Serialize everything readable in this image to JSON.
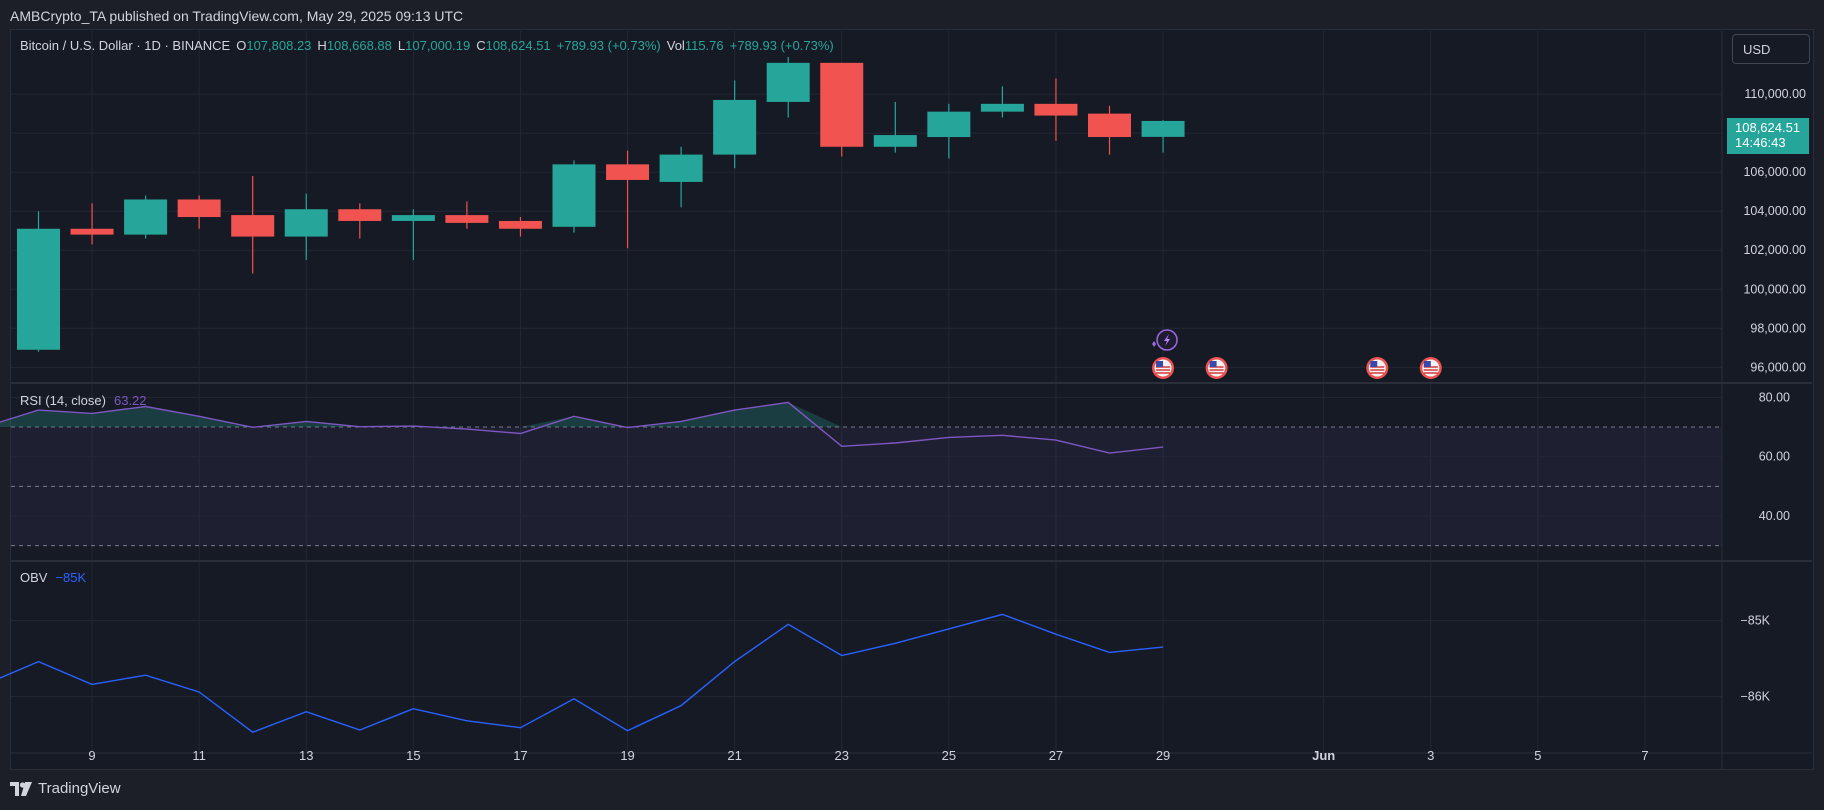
{
  "header": {
    "published": "AMBCrypto_TA published on TradingView.com, May 29, 2025 09:13 UTC"
  },
  "legend": {
    "symbol": "Bitcoin / U.S. Dollar · 1D · BINANCE",
    "o_label": "O",
    "o_value": "107,808.23",
    "h_label": "H",
    "h_value": "108,668.88",
    "l_label": "L",
    "l_value": "107,000.19",
    "c_label": "C",
    "c_value": "108,624.51",
    "change": "+789.93 (+0.73%)",
    "vol_label": "Vol",
    "vol_value": "115.76",
    "vol_change": "+789.93 (+0.73%)"
  },
  "currency_button": "USD",
  "price_tag": {
    "price": "108,624.51",
    "countdown": "14:46:43"
  },
  "brand": "TradingView",
  "colors": {
    "up": "#26a69a",
    "down": "#f05350",
    "rsi": "#7e57c2",
    "obv": "#2962ff",
    "background": "#161a25",
    "grid": "#232734",
    "text": "#d1d4dc"
  },
  "events": {
    "icons": [
      "us-flag-icon",
      "us-flag-icon",
      "us-flag-icon",
      "us-flag-icon"
    ],
    "flag_days": [
      "2025-05-29",
      "2025-05-30",
      "2025-06-02",
      "2025-06-03"
    ],
    "lightning_day": "2025-05-29",
    "lightning_icon": "lightning-icon"
  },
  "chart_data": [
    {
      "type": "candlestick",
      "title": "",
      "x_tick_labels": [
        "9",
        "11",
        "13",
        "15",
        "17",
        "19",
        "21",
        "23",
        "25",
        "27",
        "29",
        "Jun",
        "3",
        "5",
        "7"
      ],
      "x_tick_dates": [
        "2025-05-09",
        "2025-05-11",
        "2025-05-13",
        "2025-05-15",
        "2025-05-17",
        "2025-05-19",
        "2025-05-21",
        "2025-05-23",
        "2025-05-25",
        "2025-05-27",
        "2025-05-29",
        "2025-06-01",
        "2025-06-03",
        "2025-06-05",
        "2025-06-07"
      ],
      "x_range": [
        "2025-05-07",
        "2025-06-09"
      ],
      "y_tick_labels": [
        "110,000.00",
        "108,000.00",
        "106,000.00",
        "104,000.00",
        "102,000.00",
        "100,000.00",
        "98,000.00",
        "96,000.00"
      ],
      "y_ticks": [
        110000,
        108000,
        106000,
        104000,
        102000,
        100000,
        98000,
        96000
      ],
      "ylim": [
        95300,
        111900
      ],
      "candles": [
        {
          "date": "2025-05-08",
          "o": 96900,
          "h": 104000,
          "l": 96800,
          "c": 103100
        },
        {
          "date": "2025-05-09",
          "o": 103100,
          "h": 104400,
          "l": 102300,
          "c": 102800
        },
        {
          "date": "2025-05-10",
          "o": 102800,
          "h": 104800,
          "l": 102600,
          "c": 104600
        },
        {
          "date": "2025-05-11",
          "o": 104600,
          "h": 104800,
          "l": 103100,
          "c": 103700
        },
        {
          "date": "2025-05-12",
          "o": 103800,
          "h": 105800,
          "l": 100800,
          "c": 102700
        },
        {
          "date": "2025-05-13",
          "o": 102700,
          "h": 104900,
          "l": 101500,
          "c": 104100
        },
        {
          "date": "2025-05-14",
          "o": 104100,
          "h": 104400,
          "l": 102600,
          "c": 103500
        },
        {
          "date": "2025-05-15",
          "o": 103500,
          "h": 104100,
          "l": 101500,
          "c": 103800
        },
        {
          "date": "2025-05-16",
          "o": 103800,
          "h": 104500,
          "l": 103100,
          "c": 103400
        },
        {
          "date": "2025-05-17",
          "o": 103500,
          "h": 103700,
          "l": 102700,
          "c": 103100
        },
        {
          "date": "2025-05-18",
          "o": 103200,
          "h": 106600,
          "l": 102900,
          "c": 106400
        },
        {
          "date": "2025-05-19",
          "o": 106400,
          "h": 107100,
          "l": 102100,
          "c": 105600
        },
        {
          "date": "2025-05-20",
          "o": 105500,
          "h": 107300,
          "l": 104200,
          "c": 106900
        },
        {
          "date": "2025-05-21",
          "o": 106900,
          "h": 110700,
          "l": 106200,
          "c": 109700
        },
        {
          "date": "2025-05-22",
          "o": 109600,
          "h": 111900,
          "l": 108800,
          "c": 111600
        },
        {
          "date": "2025-05-23",
          "o": 111600,
          "h": 111600,
          "l": 106800,
          "c": 107300
        },
        {
          "date": "2025-05-24",
          "o": 107300,
          "h": 109600,
          "l": 107000,
          "c": 107900
        },
        {
          "date": "2025-05-25",
          "o": 107800,
          "h": 109500,
          "l": 106700,
          "c": 109100
        },
        {
          "date": "2025-05-26",
          "o": 109100,
          "h": 110400,
          "l": 108800,
          "c": 109500
        },
        {
          "date": "2025-05-27",
          "o": 109500,
          "h": 110800,
          "l": 107600,
          "c": 108900
        },
        {
          "date": "2025-05-28",
          "o": 109000,
          "h": 109400,
          "l": 106900,
          "c": 107800
        },
        {
          "date": "2025-05-29",
          "o": 107808.23,
          "h": 108668.88,
          "l": 107000.19,
          "c": 108624.51
        }
      ]
    },
    {
      "type": "line",
      "title": "RSI (14, close)",
      "last_value": "63.22",
      "y_tick_labels": [
        "80.00",
        "60.00",
        "40.00"
      ],
      "y_ticks": [
        80,
        60,
        40
      ],
      "ylim": [
        25.5,
        84.5
      ],
      "bands": [
        30,
        50,
        70
      ],
      "x": [
        "2025-05-07",
        "2025-05-08",
        "2025-05-09",
        "2025-05-10",
        "2025-05-11",
        "2025-05-12",
        "2025-05-13",
        "2025-05-14",
        "2025-05-15",
        "2025-05-16",
        "2025-05-17",
        "2025-05-18",
        "2025-05-19",
        "2025-05-20",
        "2025-05-21",
        "2025-05-22",
        "2025-05-23",
        "2025-05-24",
        "2025-05-25",
        "2025-05-26",
        "2025-05-27",
        "2025-05-28",
        "2025-05-29"
      ],
      "values": [
        70.1,
        75.7,
        74.6,
        76.9,
        73.6,
        69.9,
        71.9,
        70.1,
        70.3,
        69.3,
        67.8,
        73.6,
        69.8,
        71.9,
        75.7,
        78.3,
        63.5,
        64.6,
        66.5,
        67.2,
        65.6,
        61.2,
        63.22
      ]
    },
    {
      "type": "line",
      "title": "OBV",
      "last_value": "−85K",
      "y_tick_labels": [
        "−85K",
        "−86K"
      ],
      "y_ticks": [
        -85000,
        -86000
      ],
      "ylim": [
        -86730,
        -84230
      ],
      "x": [
        "2025-05-07",
        "2025-05-08",
        "2025-05-09",
        "2025-05-10",
        "2025-05-11",
        "2025-05-12",
        "2025-05-13",
        "2025-05-14",
        "2025-05-15",
        "2025-05-16",
        "2025-05-17",
        "2025-05-18",
        "2025-05-19",
        "2025-05-20",
        "2025-05-21",
        "2025-05-22",
        "2025-05-23",
        "2025-05-24",
        "2025-05-25",
        "2025-05-26",
        "2025-05-27",
        "2025-05-28",
        "2025-05-29"
      ],
      "values": [
        -85840,
        -85540,
        -85840,
        -85720,
        -85940,
        -86470,
        -86200,
        -86440,
        -86160,
        -86320,
        -86410,
        -86030,
        -86450,
        -86120,
        -85540,
        -85050,
        -85460,
        -85300,
        -85110,
        -84920,
        -85180,
        -85420,
        -85350
      ]
    }
  ]
}
